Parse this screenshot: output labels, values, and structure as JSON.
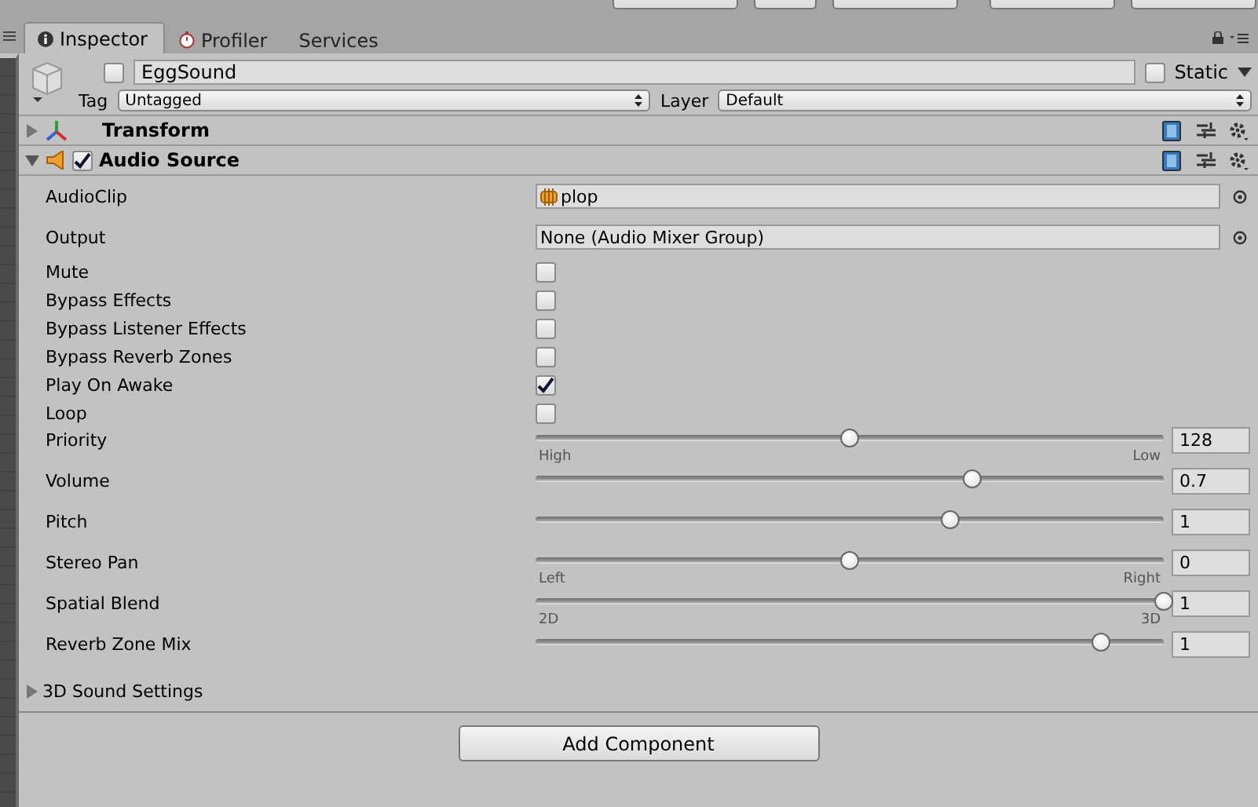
{
  "tabs": [
    {
      "label": "Inspector",
      "kind": "info",
      "selected": true
    },
    {
      "label": "Profiler",
      "kind": "profiler",
      "selected": false
    },
    {
      "label": "Services",
      "kind": "plain",
      "selected": false
    }
  ],
  "object": {
    "active": false,
    "name": "EggSound",
    "static": false,
    "static_label": "Static",
    "tag_label": "Tag",
    "tag": "Untagged",
    "layer_label": "Layer",
    "layer": "Default"
  },
  "components": [
    {
      "title": "Transform",
      "kind": "transform",
      "expanded": false
    },
    {
      "title": "Audio Source",
      "kind": "audio",
      "expanded": true,
      "enabled": true
    }
  ],
  "properties": [
    {
      "kind": "object",
      "label": "AudioClip",
      "value": "plop",
      "asset": true
    },
    {
      "kind": "object",
      "label": "Output",
      "value": "None (Audio Mixer Group)",
      "asset": false
    },
    {
      "kind": "toggle",
      "label": "Mute",
      "checked": false
    },
    {
      "kind": "toggle",
      "label": "Bypass Effects",
      "checked": false
    },
    {
      "kind": "toggle",
      "label": "Bypass Listener Effects",
      "checked": false
    },
    {
      "kind": "toggle",
      "label": "Bypass Reverb Zones",
      "checked": false
    },
    {
      "kind": "toggle",
      "label": "Play On Awake",
      "checked": true
    },
    {
      "kind": "toggle",
      "label": "Loop",
      "checked": false
    },
    {
      "kind": "slider",
      "label": "Priority",
      "level": 0.5,
      "value": "128",
      "min_label": "High",
      "max_label": "Low"
    },
    {
      "kind": "slider",
      "label": "Volume",
      "level": 0.695,
      "value": "0.7"
    },
    {
      "kind": "slider",
      "label": "Pitch",
      "level": 0.66,
      "value": "1"
    },
    {
      "kind": "slider",
      "label": "Stereo Pan",
      "level": 0.5,
      "value": "0",
      "min_label": "Left",
      "max_label": "Right"
    },
    {
      "kind": "slider",
      "label": "Spatial Blend",
      "level": 1,
      "value": "1",
      "min_label": "2D",
      "max_label": "3D"
    },
    {
      "kind": "slider",
      "label": "Reverb Zone Mix",
      "level": 0.9,
      "value": "1"
    }
  ],
  "foldout": {
    "label": "3D Sound Settings",
    "expanded": false
  },
  "add_button": "Add Component"
}
